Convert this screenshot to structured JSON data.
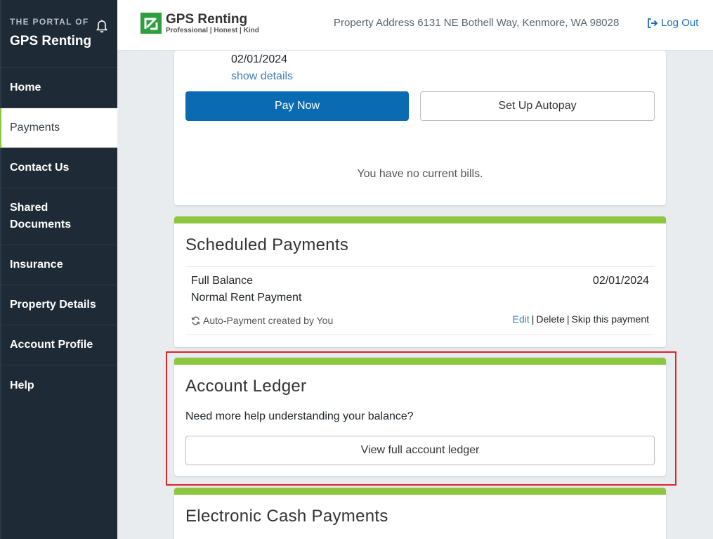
{
  "sidebar": {
    "subtitle": "THE PORTAL OF",
    "title": "GPS Renting",
    "items": [
      {
        "label": "Home",
        "height": 57
      },
      {
        "label": "Payments",
        "height": 57,
        "active": true
      },
      {
        "label": "Contact Us",
        "height": 57
      },
      {
        "label": "Shared Documents",
        "height": 81
      },
      {
        "label": "Insurance",
        "height": 57
      },
      {
        "label": "Property Details",
        "height": 57
      },
      {
        "label": "Account Profile",
        "height": 57
      },
      {
        "label": "Help",
        "height": 57
      }
    ]
  },
  "header": {
    "logo_name": "GPS Renting",
    "logo_tagline": "Professional | Honest | Kind",
    "address": "Property Address 6131 NE Bothell Way, Kenmore, WA 98028",
    "logout": "Log Out"
  },
  "bills": {
    "due_date": "02/01/2024",
    "show_details": "show details",
    "pay_now": "Pay Now",
    "autopay": "Set Up Autopay",
    "empty": "You have no current bills."
  },
  "scheduled": {
    "title": "Scheduled Payments",
    "type": "Full Balance",
    "description": "Normal Rent Payment",
    "date": "02/01/2024",
    "auto_note": "Auto-Payment created by You",
    "edit": "Edit",
    "delete": "Delete",
    "skip": "Skip this payment"
  },
  "ledger": {
    "title": "Account Ledger",
    "help": "Need more help understanding your balance?",
    "button": "View full account ledger"
  },
  "cash": {
    "title": "Electronic Cash Payments"
  },
  "colors": {
    "sidebar_bg": "#1e2a36",
    "accent_green": "#8dc63f",
    "primary_blue": "#0a6bb2",
    "highlight_red": "#d9262b"
  }
}
